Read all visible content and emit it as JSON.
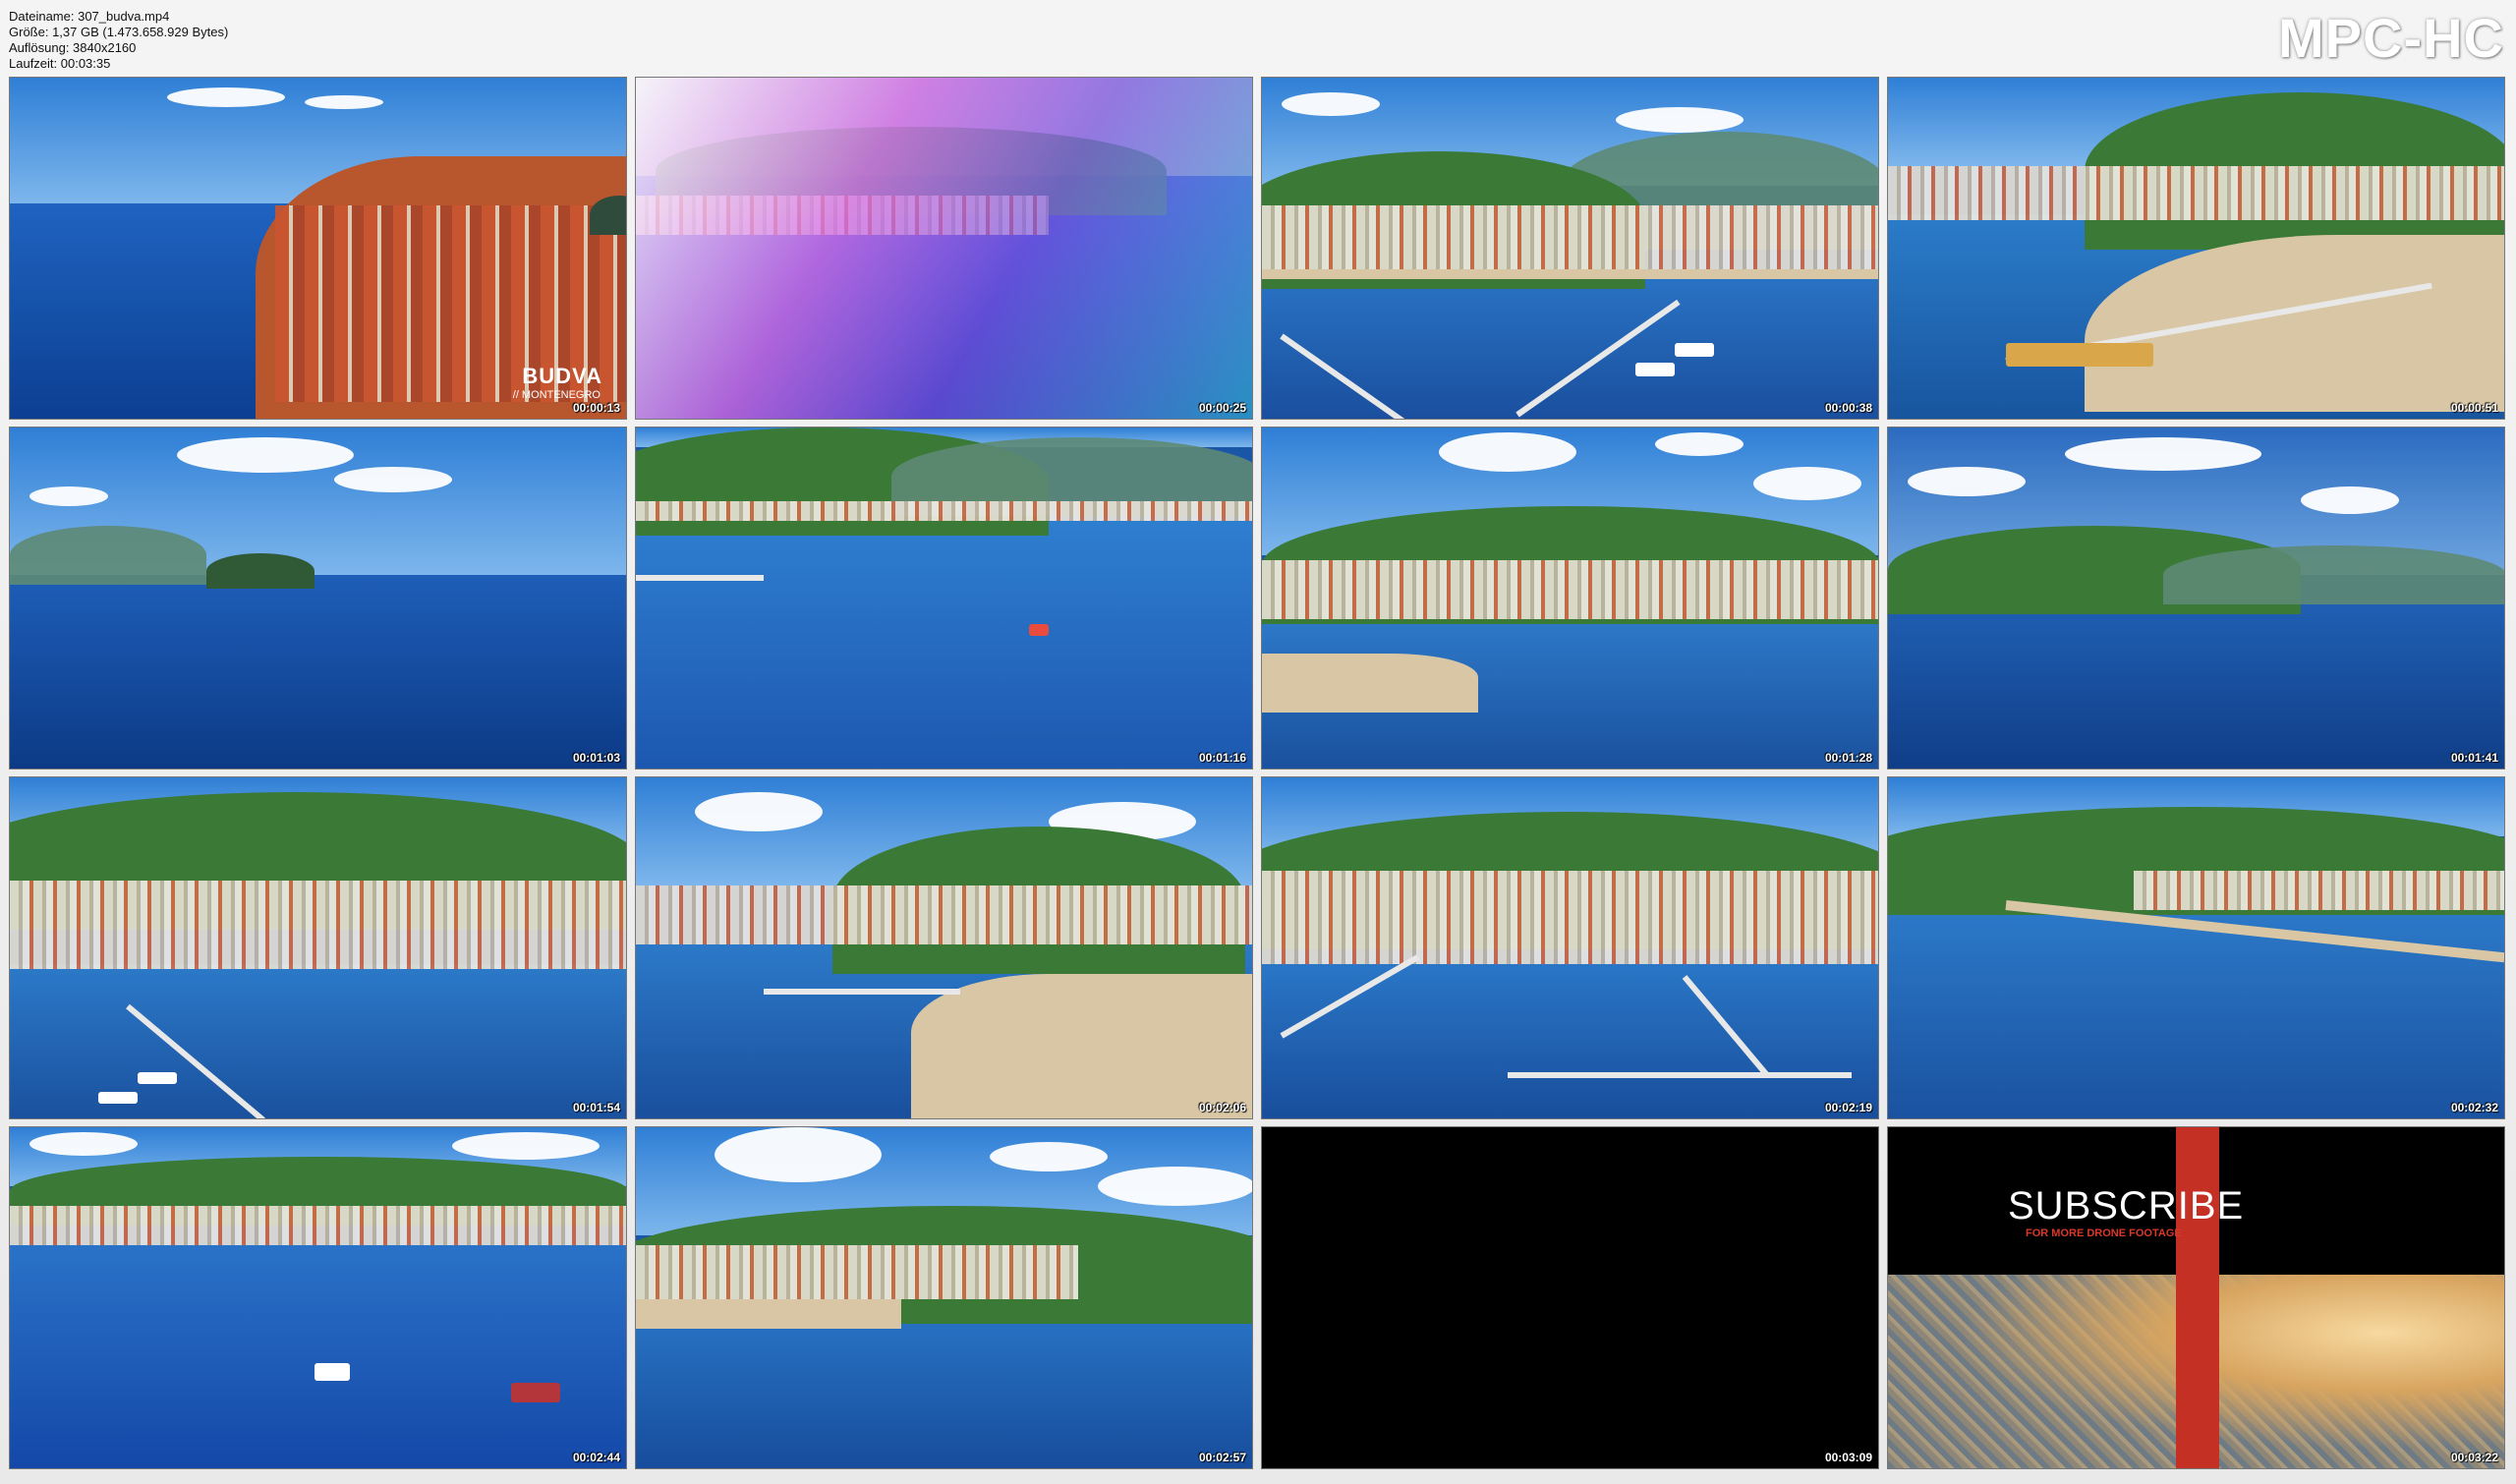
{
  "file_info": {
    "filename": "Dateiname: 307_budva.mp4",
    "size": "Größe: 1,37 GB (1.473.658.929 Bytes)",
    "resolution": "Auflösung: 3840x2160",
    "duration": "Laufzeit: 00:03:35"
  },
  "brand": "MPC-HC",
  "thumbnails": [
    {
      "timestamp": "00:00:13",
      "scene": "old-town-peninsula",
      "overlay_title": "BUDVA",
      "overlay_subtitle": "// MONTENEGRO"
    },
    {
      "timestamp": "00:00:25",
      "scene": "purple-transition"
    },
    {
      "timestamp": "00:00:38",
      "scene": "marina-town"
    },
    {
      "timestamp": "00:00:51",
      "scene": "bay-pier"
    },
    {
      "timestamp": "00:01:03",
      "scene": "island-sea"
    },
    {
      "timestamp": "00:01:16",
      "scene": "speedboat-bay"
    },
    {
      "timestamp": "00:01:28",
      "scene": "beach-town"
    },
    {
      "timestamp": "00:01:41",
      "scene": "open-sea-hills"
    },
    {
      "timestamp": "00:01:54",
      "scene": "marina-piers"
    },
    {
      "timestamp": "00:02:06",
      "scene": "beach-point"
    },
    {
      "timestamp": "00:02:19",
      "scene": "harbor-piers"
    },
    {
      "timestamp": "00:02:32",
      "scene": "coastline-bay"
    },
    {
      "timestamp": "00:02:44",
      "scene": "boats-coast"
    },
    {
      "timestamp": "00:02:57",
      "scene": "beach-clouds"
    },
    {
      "timestamp": "00:03:09",
      "scene": "black-frame"
    },
    {
      "timestamp": "00:03:22",
      "scene": "subscribe-card",
      "overlay_title": "SUBSCRIBE",
      "overlay_subtitle": "FOR MORE DRONE FOOTAGE"
    }
  ]
}
